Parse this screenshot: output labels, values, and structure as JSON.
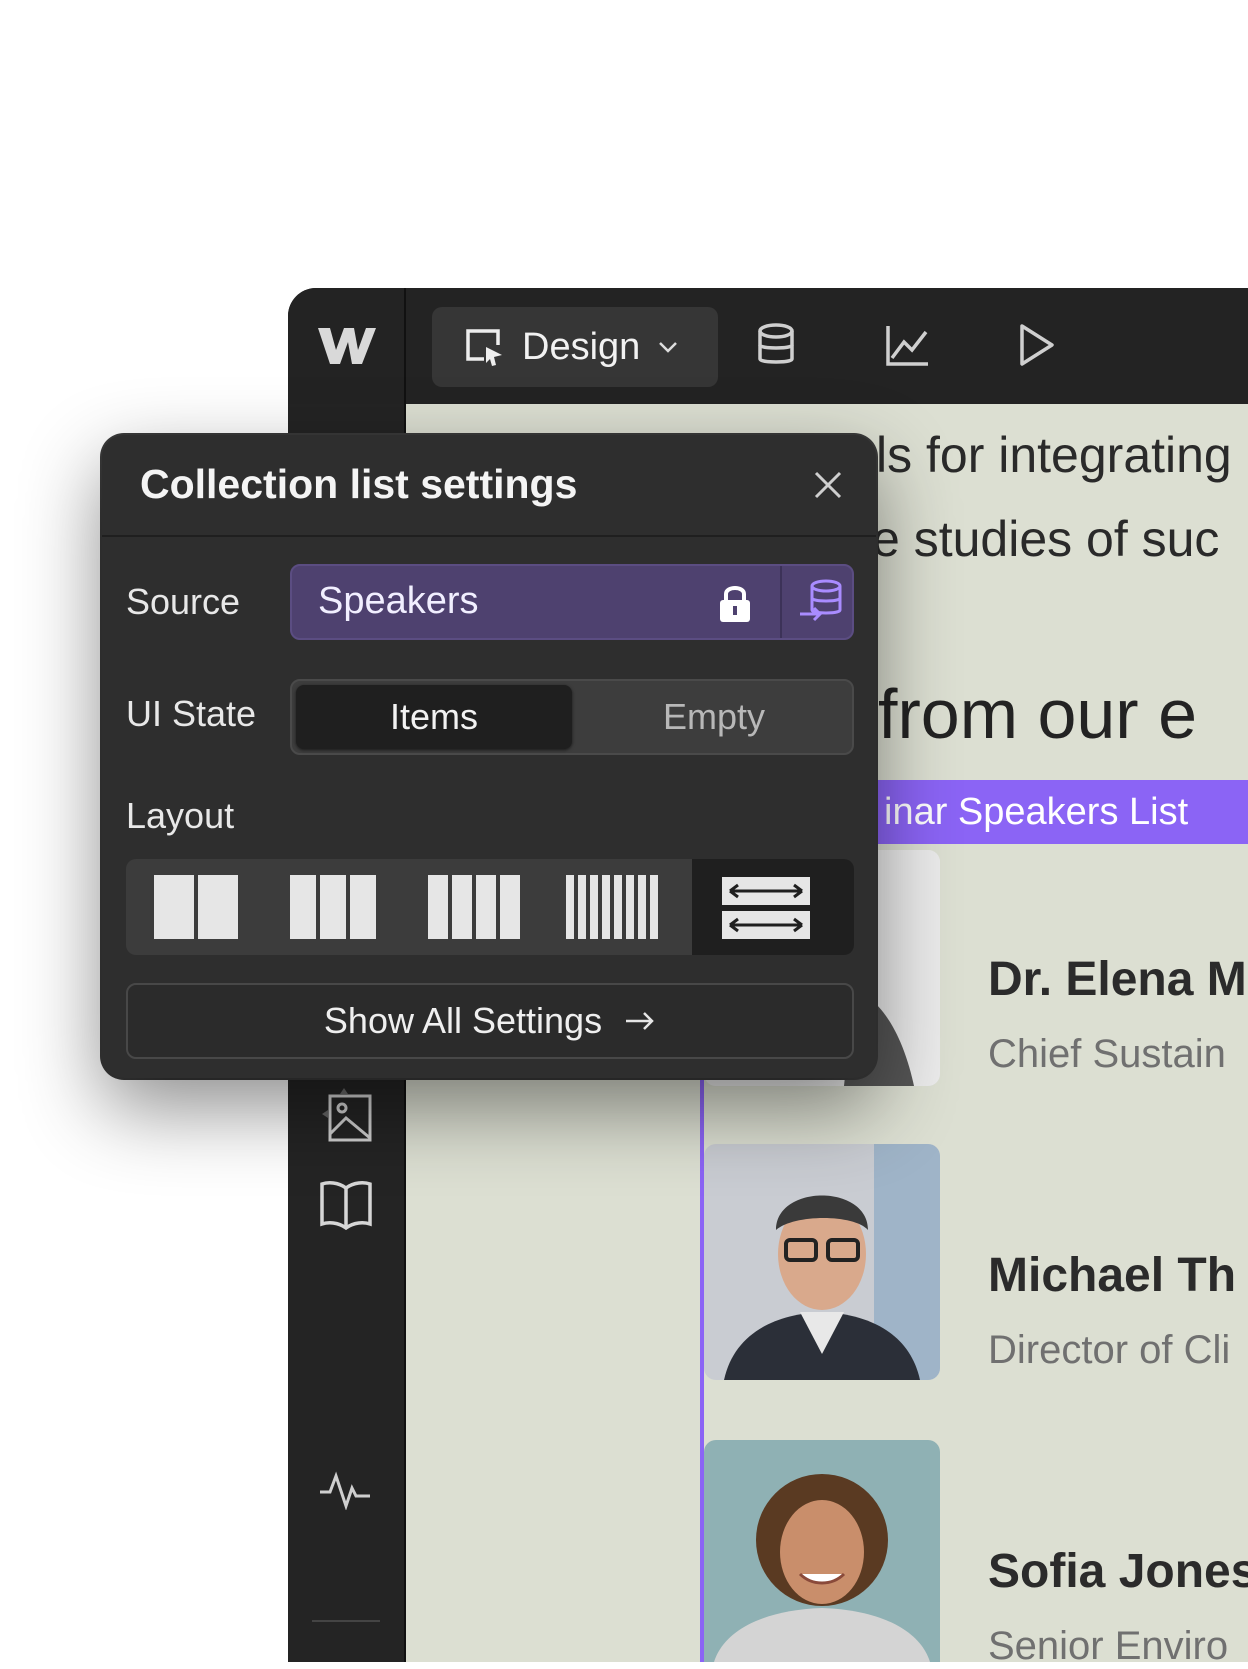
{
  "toolbar": {
    "mode_label": "Design"
  },
  "canvas": {
    "line1": "ls for integrating",
    "line2": "e studies of suc",
    "heading": "from our e",
    "collection_tag": "inar Speakers List",
    "speakers": [
      {
        "name": "Dr. Elena M",
        "title": "Chief Sustain"
      },
      {
        "name": "Michael Th",
        "title": "Director of Cli"
      },
      {
        "name": "Sofia Jones",
        "title": "Senior Enviro"
      }
    ]
  },
  "panel": {
    "title": "Collection list settings",
    "source_label": "Source",
    "source_value": "Speakers",
    "ui_state_label": "UI State",
    "ui_state_options": [
      "Items",
      "Empty"
    ],
    "ui_state_selected": "Items",
    "layout_label": "Layout",
    "layout_selected": "list",
    "show_all_label": "Show All Settings"
  },
  "colors": {
    "accent": "#8b64f5",
    "source_bg": "#4e416f",
    "canvas_bg": "#dcdfd2",
    "panel_bg": "#2e2e2e"
  },
  "icons": {
    "toolbar": [
      "webflow-logo-icon",
      "cursor-select-icon",
      "chevron-down-icon",
      "database-icon",
      "chart-icon",
      "play-icon"
    ],
    "sidebar": [
      "pen-icon",
      "image-icon",
      "book-icon",
      "apps-icon",
      "activity-icon"
    ],
    "panel": [
      "close-icon",
      "lock-icon",
      "database-link-icon",
      "arrow-right-icon"
    ]
  }
}
